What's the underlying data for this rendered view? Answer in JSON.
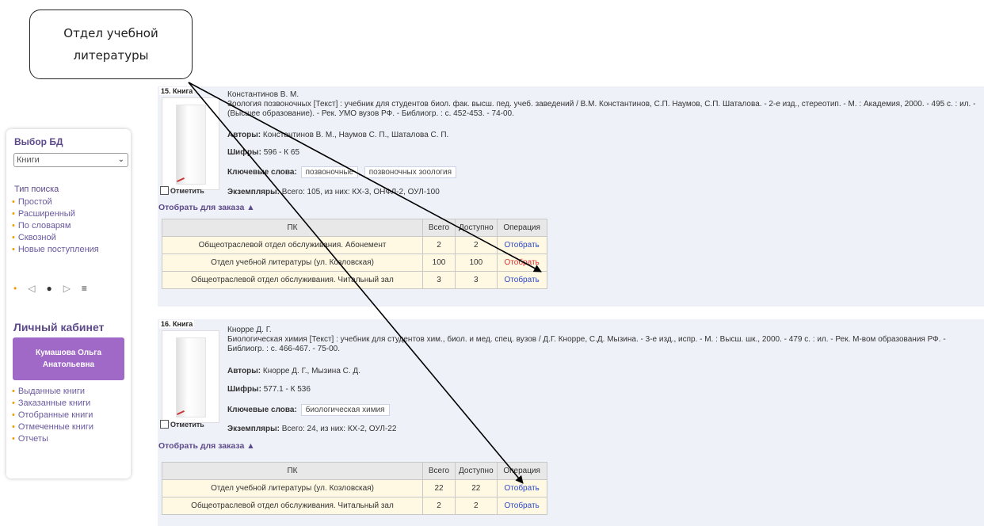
{
  "callout": {
    "text": "Отдел учебной литературы"
  },
  "sidebar": {
    "db_title": "Выбор БД",
    "db_selected": "Книги",
    "search_type_title": "Тип поиска",
    "search_types": [
      "Простой",
      "Расширенный",
      "По словарям",
      "Сквозной",
      "Новые поступления"
    ],
    "cabinet_title": "Личный кабинет",
    "user_name": "Кумашова Ольга Анатольевна",
    "cabinet_items": [
      "Выданные книги",
      "Заказанные книги",
      "Отобранные книги",
      "Отмеченные книги",
      "Отчеты"
    ]
  },
  "records": [
    {
      "num": "15. Книга",
      "author": "Константинов В. М.",
      "description": "Зоология позвоночных [Текст] : учебник для студентов биол. фак. высш. пед. учеб. заведений / В.М. Константинов, С.П. Наумов, С.П. Шаталова. - 2-е изд., стереотип. - М. : Академия, 2000. - 495 с. : ил. - (Высшее образование). - Рек. УМО вузов РФ. - Библиогр. : с. 452-453. - 74-00.",
      "authors_label": "Авторы:",
      "authors": "Константинов В. М., Наумов С. П., Шаталова С. П.",
      "codes_label": "Шифры:",
      "codes": "596 - К 65",
      "keywords_label": "Ключевые слова:",
      "keywords": [
        "позвоночные",
        "позвоночных зоология"
      ],
      "copies_label": "Экземпляры:",
      "copies": "Всего: 105, из них: КХ-3, ОНФЛ-2, ОУЛ-100",
      "mark_label": "Отметить",
      "order_label": "Отобрать для заказа ▲",
      "table_headers": [
        "ПК",
        "Всего",
        "Доступно",
        "Операция"
      ],
      "rows": [
        {
          "pk": "Общеотраслевой отдел обслуживания. Абонемент",
          "total": "2",
          "available": "2",
          "op": "Отобрать"
        },
        {
          "pk": "Отдел учебной литературы (ул. Козловская)",
          "total": "100",
          "available": "100",
          "op": "Отобрать"
        },
        {
          "pk": "Общеотраслевой отдел обслуживания. Читальный зал",
          "total": "3",
          "available": "3",
          "op": "Отобрать"
        }
      ]
    },
    {
      "num": "16. Книга",
      "author": "Кнорре Д. Г.",
      "description": "Биологическая химия [Текст] : учебник для студентов хим., биол. и мед. спец. вузов / Д.Г. Кнорре, С.Д. Мызина. - 3-е изд., испр. - М. : Высш. шк., 2000. - 479 с. : ил. - Рек. М-вом образования РФ. - Библиогр. : с. 466-467. - 75-00.",
      "authors_label": "Авторы:",
      "authors": "Кнорре Д. Г., Мызина С. Д.",
      "codes_label": "Шифры:",
      "codes": "577.1 - К 536",
      "keywords_label": "Ключевые слова:",
      "keywords": [
        "биологическая химия"
      ],
      "copies_label": "Экземпляры:",
      "copies": "Всего: 24, из них: КХ-2, ОУЛ-22",
      "mark_label": "Отметить",
      "order_label": "Отобрать для заказа ▲",
      "table_headers": [
        "ПК",
        "Всего",
        "Доступно",
        "Операция"
      ],
      "rows": [
        {
          "pk": "Отдел учебной литературы (ул. Козловская)",
          "total": "22",
          "available": "22",
          "op": "Отобрать"
        },
        {
          "pk": "Общеотраслевой отдел обслуживания. Читальный зал",
          "total": "2",
          "available": "2",
          "op": "Отобрать"
        }
      ]
    }
  ],
  "colors": {
    "accent": "#5d4a8a",
    "user_button": "#a069c8",
    "link": "#2a48c8",
    "link_active": "#e03030",
    "row_bg": "#fff8e3"
  }
}
